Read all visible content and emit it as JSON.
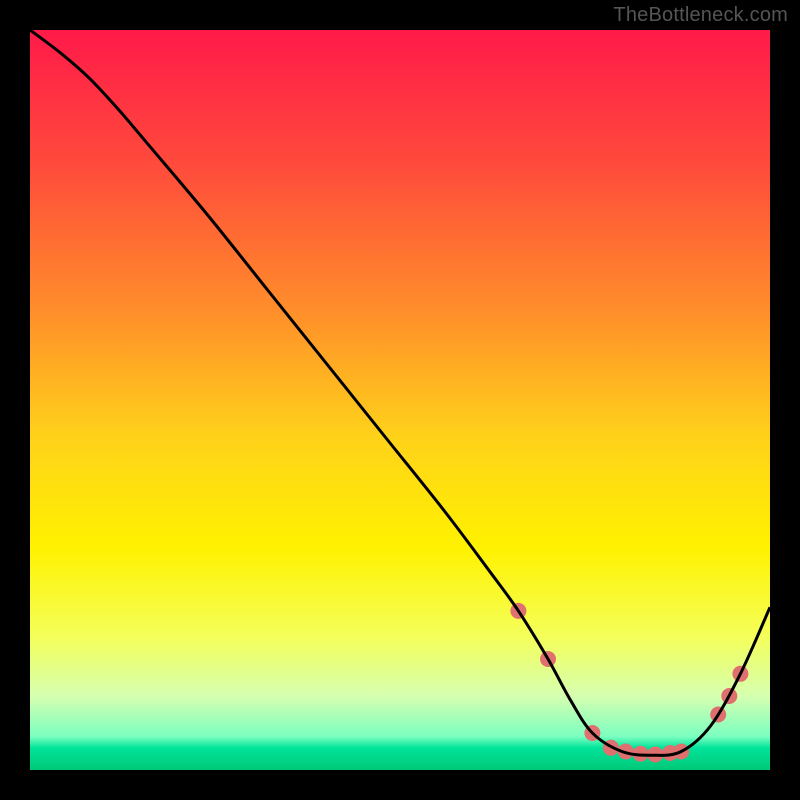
{
  "watermark": "TheBottleneck.com",
  "chart_data": {
    "type": "line",
    "title": "",
    "xlabel": "",
    "ylabel": "",
    "xlim": [
      0,
      100
    ],
    "ylim": [
      0,
      100
    ],
    "grid": false,
    "legend": false,
    "background_gradient": {
      "stops": [
        {
          "offset": 0,
          "color": "#ff1a49"
        },
        {
          "offset": 18,
          "color": "#ff4a3c"
        },
        {
          "offset": 38,
          "color": "#ff8e2a"
        },
        {
          "offset": 55,
          "color": "#ffd21a"
        },
        {
          "offset": 70,
          "color": "#fff200"
        },
        {
          "offset": 82,
          "color": "#f4ff5a"
        },
        {
          "offset": 90,
          "color": "#d6ffb0"
        },
        {
          "offset": 95.5,
          "color": "#7bffc0"
        },
        {
          "offset": 97,
          "color": "#00e49a"
        },
        {
          "offset": 100,
          "color": "#00c878"
        }
      ]
    },
    "series": [
      {
        "name": "curve",
        "color": "#000000",
        "x": [
          0,
          4,
          8,
          12,
          16,
          24,
          32,
          40,
          48,
          56,
          62,
          66,
          70,
          73,
          76,
          80,
          84,
          88,
          92,
          96,
          100
        ],
        "y": [
          100,
          97,
          93.5,
          89.2,
          84.5,
          75,
          65,
          55,
          45,
          35,
          27,
          21.5,
          15,
          9.5,
          5,
          2.5,
          2,
          2.5,
          6,
          13,
          22
        ]
      }
    ],
    "markers": {
      "name": "dots",
      "color": "#e07070",
      "radius": 8,
      "points": [
        {
          "x": 66,
          "y": 21.5
        },
        {
          "x": 70,
          "y": 15
        },
        {
          "x": 76,
          "y": 5
        },
        {
          "x": 78.5,
          "y": 3
        },
        {
          "x": 80.5,
          "y": 2.5
        },
        {
          "x": 82.5,
          "y": 2.2
        },
        {
          "x": 84.5,
          "y": 2.1
        },
        {
          "x": 86.5,
          "y": 2.3
        },
        {
          "x": 88,
          "y": 2.5
        },
        {
          "x": 93,
          "y": 7.5
        },
        {
          "x": 94.5,
          "y": 10
        },
        {
          "x": 96,
          "y": 13
        }
      ]
    }
  }
}
